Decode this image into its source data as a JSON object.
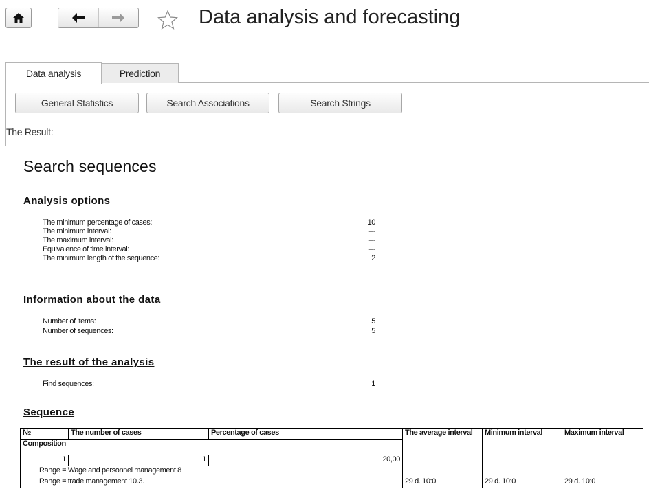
{
  "header": {
    "title": "Data analysis and forecasting",
    "icons": [
      "home-icon",
      "arrow-left-icon",
      "arrow-right-icon",
      "star-icon"
    ]
  },
  "tabs": [
    {
      "label": "Data analysis",
      "active": true
    },
    {
      "label": "Prediction",
      "active": false
    }
  ],
  "actions": {
    "general_statistics": "General Statistics",
    "search_associations": "Search Associations",
    "search_strings": "Search Strings"
  },
  "result_label": "The Result:",
  "report": {
    "title": "Search sequences",
    "analysis_options": {
      "heading": "Analysis options",
      "rows": [
        {
          "label": "The minimum percentage of cases:",
          "value": "10"
        },
        {
          "label": "The minimum interval:",
          "value": "---"
        },
        {
          "label": "The maximum interval:",
          "value": "---"
        },
        {
          "label": "Equivalence of time interval:",
          "value": "---"
        },
        {
          "label": "The minimum length of the sequence:",
          "value": "2"
        }
      ]
    },
    "data_info": {
      "heading": "Information about the data",
      "rows": [
        {
          "label": "Number of items:",
          "value": "5"
        },
        {
          "label": "Number of sequences:",
          "value": "5"
        }
      ]
    },
    "analysis_result": {
      "heading": "The result of the analysis",
      "rows": [
        {
          "label": "Find sequences:",
          "value": "1"
        }
      ]
    },
    "sequence": {
      "heading": "Sequence",
      "columns": {
        "no": "№",
        "cases": "The number of cases",
        "percentage": "Percentage of cases",
        "avg_interval": "The average interval",
        "min_interval": "Minimum interval",
        "max_interval": "Maximum interval",
        "composition": "Composition"
      },
      "rows": [
        {
          "no": "1",
          "cases": "1",
          "percentage": "20,00"
        }
      ],
      "composition": [
        {
          "text": "Range = Wage and personnel management 8",
          "avg": "",
          "min": "",
          "max": ""
        },
        {
          "text": "Range = trade management 10.3.",
          "avg": "29 d. 10:0",
          "min": "29 d. 10:0",
          "max": "29 d. 10:0"
        }
      ]
    }
  }
}
